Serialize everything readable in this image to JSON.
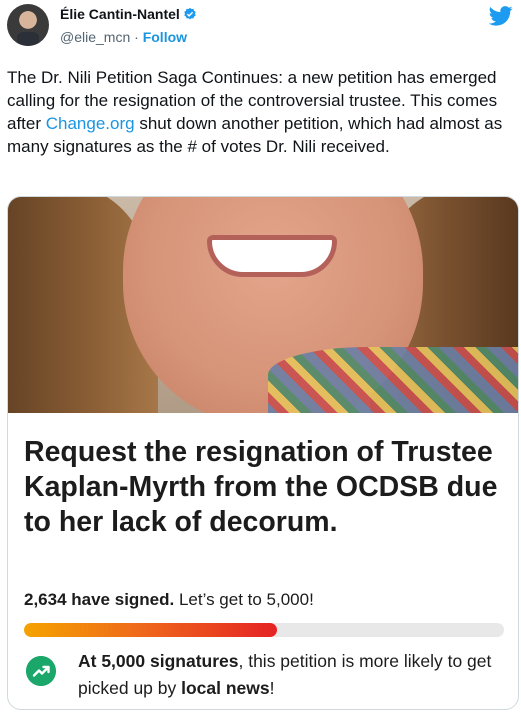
{
  "tweet": {
    "author": {
      "name": "Élie Cantin-Nantel",
      "handle": "@elie_mcn",
      "separator": " · ",
      "follow_label": "Follow"
    },
    "text_before_link": "The Dr. Nili Petition Saga Continues: a new petition has emerged calling for the resignation of the controversial trustee. This comes after ",
    "link_text": "Change.org",
    "text_after_link": " shut down another petition, which had almost as many signatures as the # of votes Dr. Nili received."
  },
  "card": {
    "title": "Request the resignation of Trustee Kaplan-Myrth from the OCDSB due to her lack of decorum.",
    "signed_count": "2,634 have signed.",
    "signed_goal": " Let’s get to 5,000!",
    "progress_fraction": 0.527,
    "note_bold_1": "At 5,000 signatures",
    "note_mid": ", this petition is more likely to get picked up by ",
    "note_bold_2": "local news",
    "note_end": "!"
  },
  "icons": {
    "verified": "verified-badge-icon",
    "brand": "twitter-bird-icon",
    "trend": "trending-up-icon"
  },
  "colors": {
    "link": "#1b95e0",
    "verified": "#1d9bf0",
    "progress_start": "#f5a300",
    "progress_end": "#e52323",
    "trend_bg": "#1aa769"
  }
}
